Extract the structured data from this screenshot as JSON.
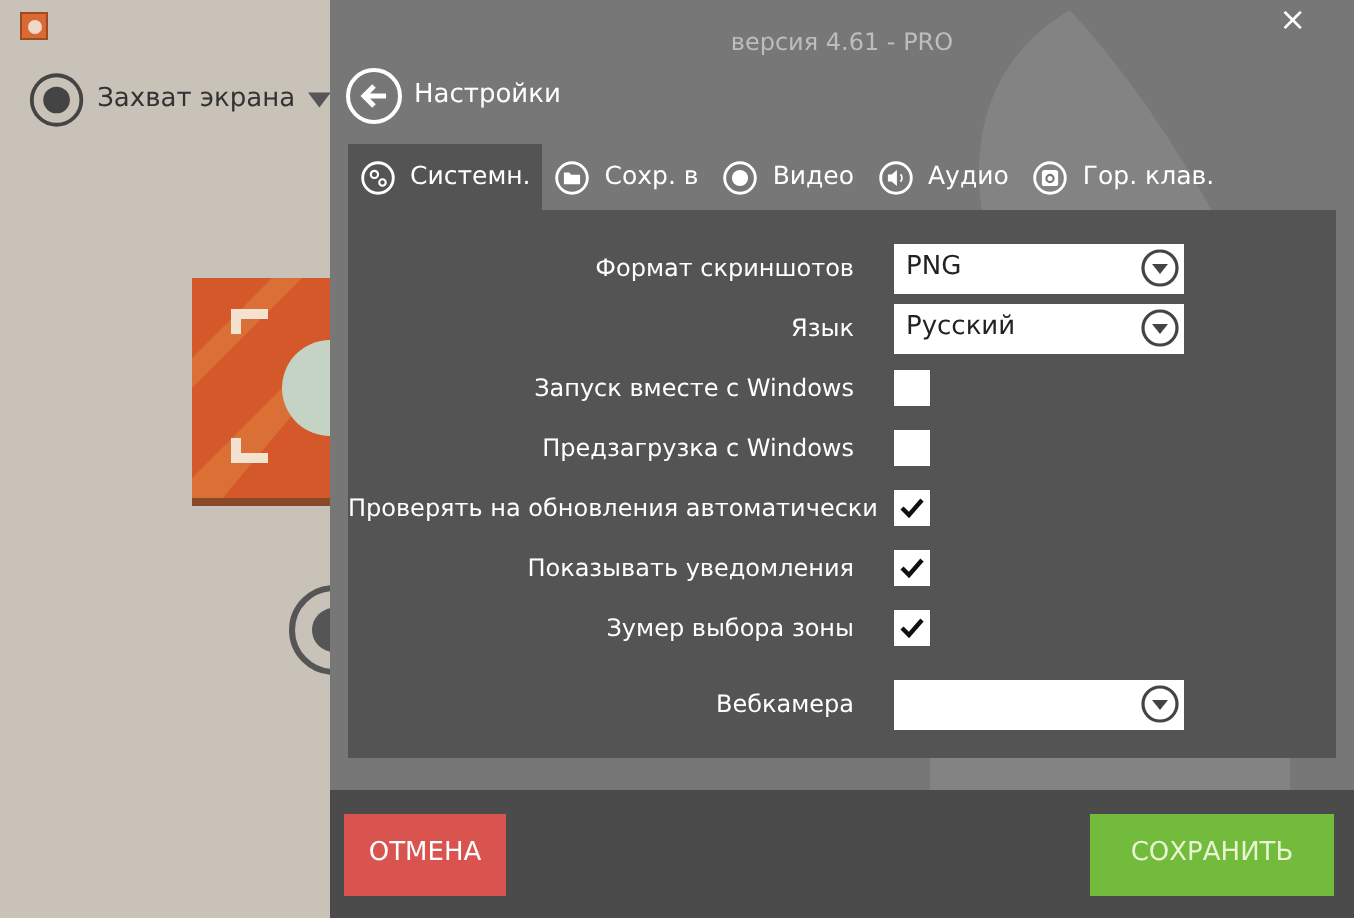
{
  "window": {
    "version": "версия 4.61 - PRO",
    "close": "×"
  },
  "capture_mode": {
    "label": "Захват экрана"
  },
  "header": {
    "title": "Настройки"
  },
  "tabs": [
    {
      "label": "Системн.",
      "kind": "gears",
      "selected": true
    },
    {
      "label": "Сохр. в",
      "kind": "folder",
      "selected": false
    },
    {
      "label": "Видео",
      "kind": "record",
      "selected": false
    },
    {
      "label": "Аудио",
      "kind": "speaker",
      "selected": false
    },
    {
      "label": "Гор. клав.",
      "kind": "key",
      "selected": false
    }
  ],
  "settings": [
    {
      "kind": "select",
      "label": "Формат скриншотов",
      "value": "PNG"
    },
    {
      "kind": "select",
      "label": "Язык",
      "value": "Русский"
    },
    {
      "kind": "checkbox",
      "label": "Запуск вместе с Windows",
      "checked": false
    },
    {
      "kind": "checkbox",
      "label": "Предзагрузка с Windows",
      "checked": false
    },
    {
      "kind": "checkbox",
      "label": "Проверять на обновления автоматически",
      "checked": true
    },
    {
      "kind": "checkbox",
      "label": "Показывать уведомления",
      "checked": true
    },
    {
      "kind": "checkbox",
      "label": "Зумер выбора зоны",
      "checked": true
    },
    {
      "kind": "select",
      "label": "Вебкамера"
    }
  ],
  "buttons": {
    "cancel": "ОТМЕНА",
    "save": "СОХРАНИТЬ"
  }
}
